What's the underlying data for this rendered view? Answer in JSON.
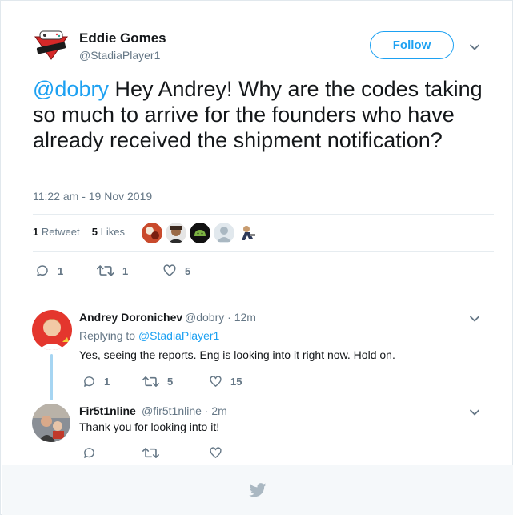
{
  "main_tweet": {
    "author_name": "Eddie Gomes",
    "author_handle": "@StadiaPlayer1",
    "avatar_text": "PLAYER 1",
    "follow_label": "Follow",
    "mention": "@dobry",
    "text": " Hey Andrey! Why are the codes taking so much to arrive for the founders who have already received the shipment notification?",
    "timestamp": "11:22 am - 19 Nov 2019",
    "retweet_count": "1",
    "retweet_label": "Retweet",
    "like_count": "5",
    "like_label": "Likes",
    "reply_action_count": "1",
    "retweet_action_count": "1",
    "like_action_count": "5"
  },
  "replies": [
    {
      "name": "Andrey Doronichev",
      "handle": "@dobry",
      "time": "12m",
      "replying_prefix": "Replying to",
      "replying_to": "@StadiaPlayer1",
      "text": "Yes, seeing the reports. Eng is looking into it right now. Hold on.",
      "reply_count": "1",
      "retweet_count": "5",
      "like_count": "15"
    },
    {
      "name": "Fir5t1nline",
      "handle": "@fir5t1nline",
      "time": "2m",
      "text": "Thank you for looking into it!",
      "reply_count": "",
      "retweet_count": "",
      "like_count": ""
    }
  ],
  "colors": {
    "brand": "#1da1f2",
    "text": "#14171a",
    "muted": "#657786",
    "thread_line": "#a6d5f2",
    "like_icon": "#657786"
  },
  "icons": [
    "player1-logo-icon",
    "chevron-down-icon",
    "reply-icon",
    "retweet-icon",
    "heart-icon",
    "twitter-bird-icon"
  ]
}
